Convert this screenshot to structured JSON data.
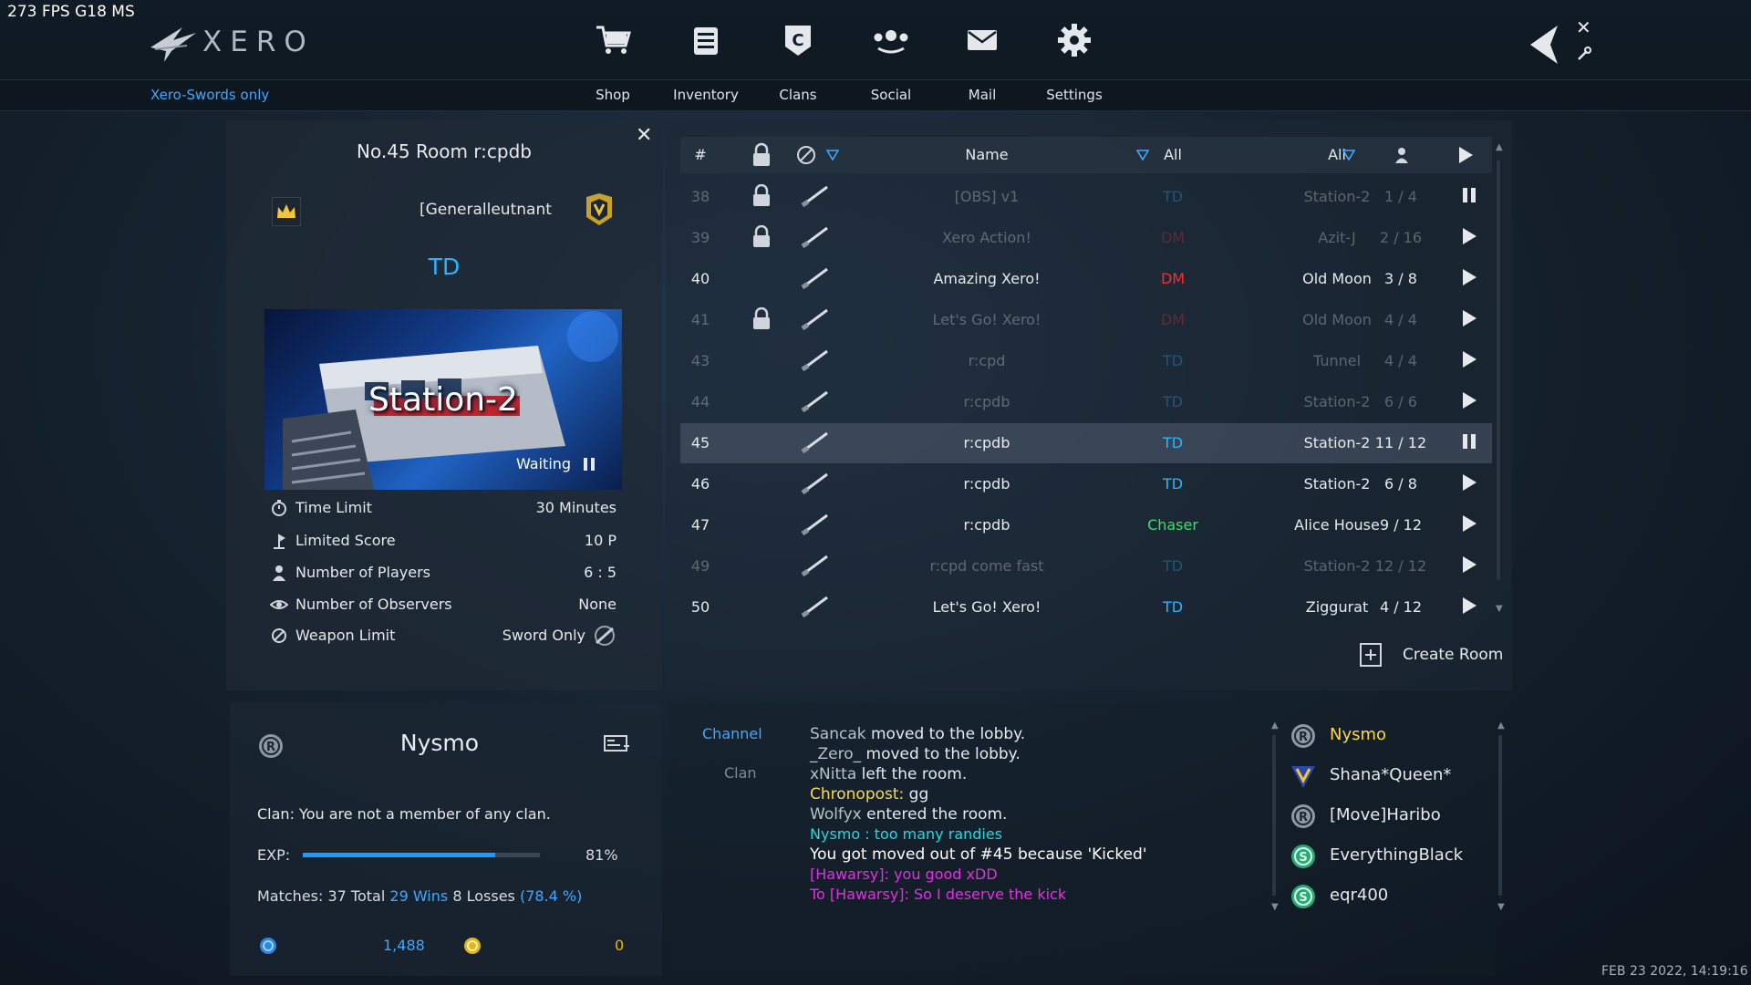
{
  "hud": {
    "fps": "273 FPS  G18 MS",
    "datetime": "FEB 23 2022, 14:19:16"
  },
  "brand": {
    "logo_text": "XERO",
    "filter_label": "Xero-Swords only"
  },
  "nav": [
    {
      "label": "Shop",
      "icon": "cart-icon"
    },
    {
      "label": "Inventory",
      "icon": "inventory-icon"
    },
    {
      "label": "Clans",
      "icon": "clan-icon"
    },
    {
      "label": "Social",
      "icon": "social-icon"
    },
    {
      "label": "Mail",
      "icon": "mail-icon"
    },
    {
      "label": "Settings",
      "icon": "gear-icon"
    }
  ],
  "room": {
    "title": "No.45 Room r:cpdb",
    "host_rank": "[Generalleutnant",
    "mode": "TD",
    "map_name": "Station-2",
    "status": "Waiting",
    "info": [
      {
        "label": "Time Limit",
        "value": "30 Minutes",
        "icon": "timer-icon"
      },
      {
        "label": "Limited Score",
        "value": "10 P",
        "icon": "score-icon"
      },
      {
        "label": "Number of Players",
        "value": "6 : 5",
        "icon": "players-icon"
      },
      {
        "label": "Number of Observers",
        "value": "None",
        "icon": "observer-icon"
      },
      {
        "label": "Weapon Limit",
        "value": "Sword Only",
        "icon": "weapon-limit-icon"
      }
    ]
  },
  "room_list": {
    "headers": {
      "num": "#",
      "name": "Name",
      "mode_filter": "All",
      "map_filter": "All"
    },
    "rows": [
      {
        "num": "38",
        "locked": true,
        "name": "[OBS] v1",
        "mode": "TD",
        "map": "Station-2",
        "players": "1 / 4",
        "action": "pause",
        "dim": true
      },
      {
        "num": "39",
        "locked": true,
        "name": "Xero Action!",
        "mode": "DM",
        "map": "Azit-J",
        "players": "2 / 16",
        "action": "play",
        "dim": true
      },
      {
        "num": "40",
        "locked": false,
        "name": "Amazing Xero!",
        "mode": "DM",
        "map": "Old Moon",
        "players": "3 / 8",
        "action": "play",
        "dim": false
      },
      {
        "num": "41",
        "locked": true,
        "name": "Let's Go! Xero!",
        "mode": "DM",
        "map": "Old Moon",
        "players": "4 / 4",
        "action": "play",
        "dim": true
      },
      {
        "num": "43",
        "locked": false,
        "name": "r:cpd",
        "mode": "TD",
        "map": "Tunnel",
        "players": "4 / 4",
        "action": "play",
        "dim": true
      },
      {
        "num": "44",
        "locked": false,
        "name": "r:cpdb",
        "mode": "TD",
        "map": "Station-2",
        "players": "6 / 6",
        "action": "play",
        "dim": true
      },
      {
        "num": "45",
        "locked": false,
        "name": "r:cpdb",
        "mode": "TD",
        "map": "Station-2",
        "players": "11 / 12",
        "action": "pause",
        "dim": false,
        "selected": true
      },
      {
        "num": "46",
        "locked": false,
        "name": "r:cpdb",
        "mode": "TD",
        "map": "Station-2",
        "players": "6 / 8",
        "action": "play",
        "dim": false
      },
      {
        "num": "47",
        "locked": false,
        "name": "r:cpdb",
        "mode": "Chaser",
        "map": "Alice House",
        "players": "9 / 12",
        "action": "play",
        "dim": false
      },
      {
        "num": "49",
        "locked": false,
        "name": "r:cpd   come fast",
        "mode": "TD",
        "map": "Station-2",
        "players": "12 / 12",
        "action": "play",
        "dim": true
      },
      {
        "num": "50",
        "locked": false,
        "name": "Let's Go! Xero!",
        "mode": "TD",
        "map": "Ziggurat",
        "players": "4 / 12",
        "action": "play",
        "dim": false
      }
    ],
    "create_label": "Create Room"
  },
  "colors": {
    "TD": "#29b6ff",
    "DM": "#ff2a2a",
    "Chaser": "#39e06a",
    "accent": "#3fa8ff",
    "gold": "#ffd84a"
  },
  "profile": {
    "name": "Nysmo",
    "clan": "Clan:   You are not a member of any clan.",
    "exp_label": "EXP:",
    "exp_pct": "81%",
    "exp_fraction": 0.81,
    "matches_prefix": "Matches: ",
    "matches_total": "37 Total",
    "wins": "29 Wins",
    "losses": "8 Losses",
    "win_pct": "(78.4 %)",
    "currency1": "1,488",
    "currency2": "0"
  },
  "chat": {
    "tabs": [
      "Channel",
      "Clan"
    ],
    "messages": [
      {
        "type": "sys",
        "who": "Sancak",
        "text": " moved to the lobby."
      },
      {
        "type": "sys",
        "who": "_Zero_",
        "text": " moved to the lobby."
      },
      {
        "type": "sys",
        "who": "xNitta",
        "text": " left the room."
      },
      {
        "type": "gold",
        "who": "Chronopost:",
        "text": " gg"
      },
      {
        "type": "sys",
        "who": "Wolfyx",
        "text": " entered the room."
      },
      {
        "type": "cyan",
        "who": "",
        "text": "Nysmo : too many randies"
      },
      {
        "type": "white",
        "who": "",
        "text": "You got moved out of #45 because 'Kicked'"
      },
      {
        "type": "mag",
        "who": "",
        "text": "[Hawarsy]: you good xDD"
      },
      {
        "type": "mag",
        "who": "",
        "text": "To [Hawarsy]: So I deserve the kick"
      }
    ]
  },
  "players": [
    {
      "name": "Nysmo",
      "icon": "rank-r-icon",
      "me": true
    },
    {
      "name": "Shana*Queen*",
      "icon": "rank-v-icon",
      "me": false
    },
    {
      "name": "[Move]Haribo",
      "icon": "rank-r-icon",
      "me": false
    },
    {
      "name": "EverythingBlack",
      "icon": "rank-s-icon",
      "me": false
    },
    {
      "name": "eqr400",
      "icon": "rank-s-icon",
      "me": false
    }
  ]
}
